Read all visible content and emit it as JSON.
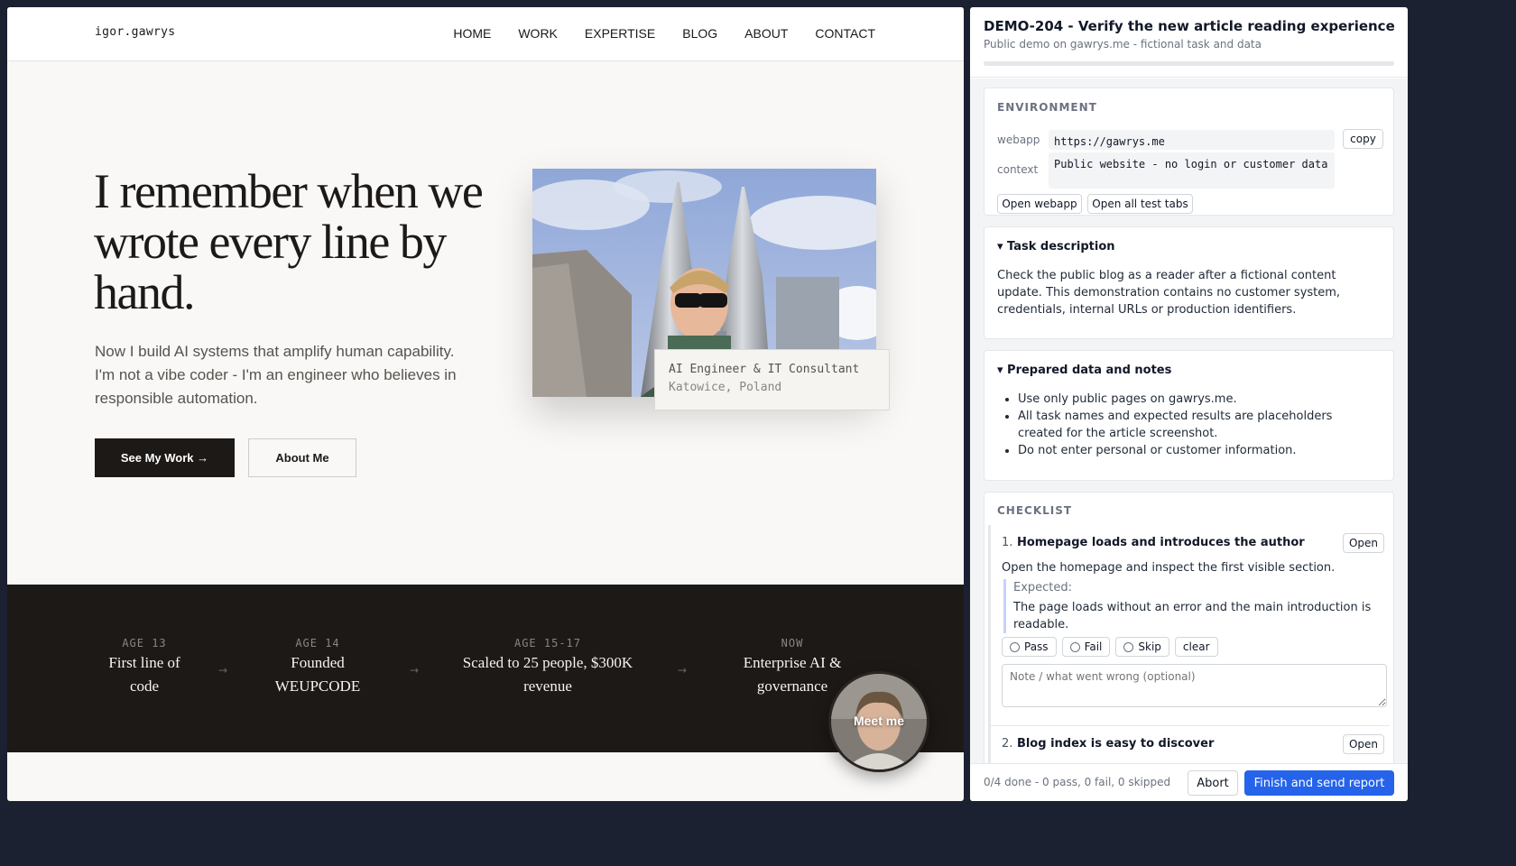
{
  "site": {
    "logo": "igor.gawrys",
    "nav": [
      "HOME",
      "WORK",
      "EXPERTISE",
      "BLOG",
      "ABOUT",
      "CONTACT"
    ],
    "hero_title": "I remember when we wrote every line by hand.",
    "hero_subtitle": "Now I build AI systems that amplify human capability. I'm not a vibe coder - I'm an engineer who believes in responsible automation.",
    "primary_button": "See My Work →",
    "secondary_button": "About Me",
    "caption_role": "AI Engineer & IT Consultant",
    "caption_location": "Katowice, Poland",
    "timeline": [
      {
        "age": "AGE 13",
        "text": "First line of code"
      },
      {
        "age": "AGE 14",
        "text": "Founded WEUPCODE"
      },
      {
        "age": "AGE 15-17",
        "text": "Scaled to 25 people, $300K revenue"
      },
      {
        "age": "NOW",
        "text": "Enterprise AI & governance"
      }
    ],
    "timeline_arrow": "→",
    "meet_me": "Meet me",
    "colors": {
      "dark": "#1c1917",
      "background": "#f9f8f6"
    }
  },
  "panel": {
    "title": "DEMO-204 - Verify the new article reading experience",
    "subtitle": "Public demo on gawrys.me - fictional task and data",
    "progress_fraction": 0,
    "environment": {
      "label": "ENVIRONMENT",
      "webapp_key": "webapp",
      "webapp_value": "https://gawrys.me",
      "copy_label": "copy",
      "context_key": "context",
      "context_value": "Public website - no login or customer data",
      "open_webapp": "Open webapp",
      "open_all_tabs": "Open all test tabs"
    },
    "task": {
      "title": "▾ Task description",
      "text": "Check the public blog as a reader after a fictional content update. This demonstration contains no customer system, credentials, internal URLs or production identifiers."
    },
    "notes": {
      "title": "▾ Prepared data and notes",
      "items": [
        "Use only public pages on gawrys.me.",
        "All task names and expected results are placeholders created for the article screenshot.",
        "Do not enter personal or customer information."
      ]
    },
    "checklist": {
      "label": "CHECKLIST",
      "items": [
        {
          "num": "1.",
          "title": "Homepage loads and introduces the author",
          "open": "Open",
          "step": "Open the homepage and inspect the first visible section.",
          "expected_label": "Expected:",
          "expected": "The page loads without an error and the main introduction is readable.",
          "pass": "Pass",
          "fail": "Fail",
          "skip": "Skip",
          "clear": "clear",
          "note_placeholder": "Note / what went wrong (optional)"
        },
        {
          "num": "2.",
          "title": "Blog index is easy to discover",
          "open": "Open"
        }
      ]
    },
    "footer": {
      "status": "0/4 done - 0 pass, 0 fail, 0 skipped",
      "abort": "Abort",
      "finish": "Finish and send report"
    },
    "colors": {
      "accent": "#2563eb"
    }
  }
}
